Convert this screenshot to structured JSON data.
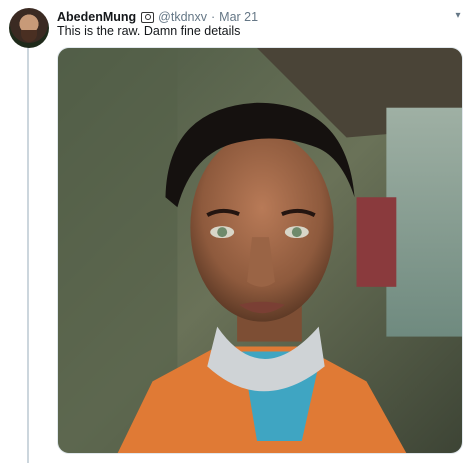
{
  "tweet": {
    "display_name": "AbedenMung",
    "badge_icon": "camera-icon",
    "handle": "@tkdnxv",
    "separator": "·",
    "time": "Mar 21",
    "text": "This is the raw. Damn fine details",
    "caret_icon": "chevron-down-icon",
    "media": {
      "kind": "photo",
      "subject_icon": "portrait-photo"
    }
  },
  "colors": {
    "name": "#14171a",
    "secondary": "#657786",
    "thread_line": "#ccd6dd"
  }
}
